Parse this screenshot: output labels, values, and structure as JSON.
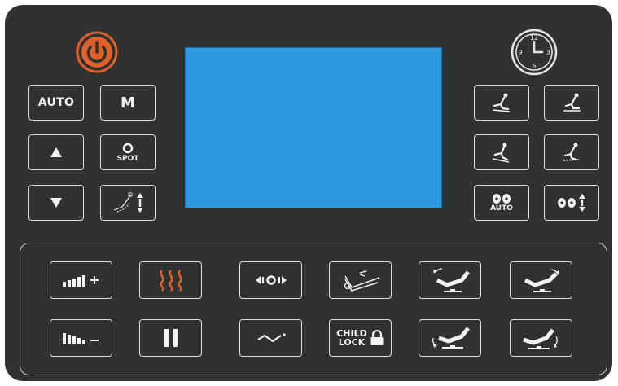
{
  "colors": {
    "panel": "#2f3230",
    "display": "#2d9ae0",
    "accent": "#e0602a",
    "icon": "#f2f2f2"
  },
  "top": {
    "power_icon": "power-icon",
    "clock_icon": "clock-icon",
    "clock_numbers": [
      "12",
      "3",
      "6",
      "9"
    ]
  },
  "left_buttons": {
    "auto_label": "AUTO",
    "manual_label": "M",
    "spot_label": "SPOT",
    "up_icon": "triangle-up-icon",
    "down_icon": "triangle-down-icon",
    "position_icon": "chair-position-adjust-icon"
  },
  "right_buttons": {
    "roller_auto_label": "AUTO",
    "programs": [
      "massage-program-1-icon",
      "massage-program-2-icon",
      "massage-program-3-icon",
      "massage-program-4-icon"
    ]
  },
  "bottom_buttons": {
    "child_lock_line1": "CHILD",
    "child_lock_line2": "LOCK",
    "icons": [
      "intensity-up-icon",
      "heat-icon",
      "width-adjust-icon",
      "leg-massage-icon",
      "recline-back-icon",
      "recline-forward-icon",
      "intensity-down-icon",
      "pause-icon",
      "wave-icon",
      "lock-icon",
      "zero-gravity-icon",
      "leg-rest-icon"
    ]
  }
}
